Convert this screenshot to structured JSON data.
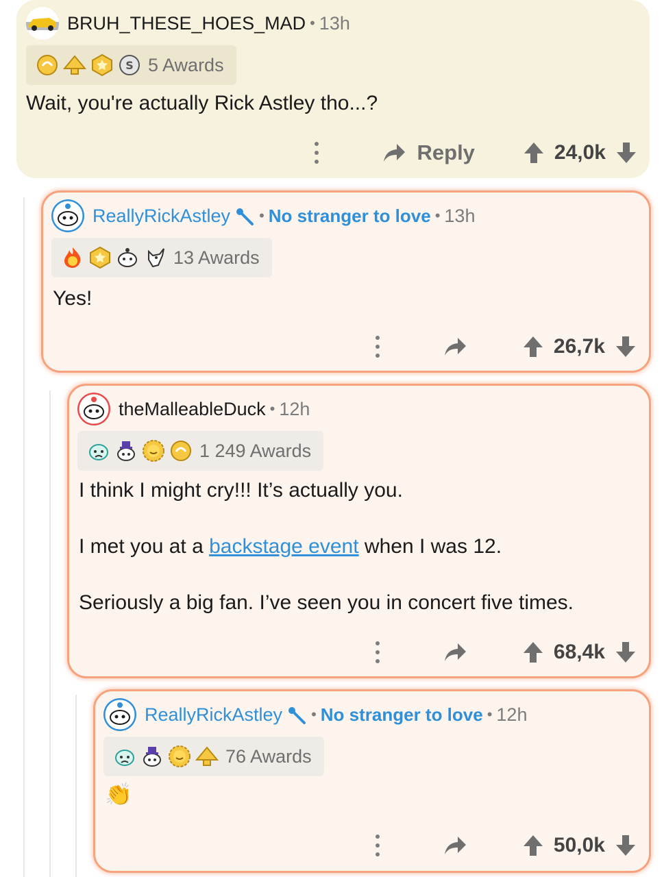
{
  "comments": [
    {
      "username": "BRUH_THESE_HOES_MAD",
      "time": "13h",
      "award_count_label": "5 Awards",
      "award_icons": [
        "wholesome-seal-icon",
        "gold-pyramid-icon",
        "star-badge-icon",
        "silver-coin-icon"
      ],
      "body": "Wait, you're actually Rick Astley tho...?",
      "reply_label": "Reply",
      "score": "24,0k"
    },
    {
      "username": "ReallyRickAstley",
      "flair": "No stranger to love",
      "time": "13h",
      "award_count_label": "13 Awards",
      "award_icons": [
        "fire-award-icon",
        "star-badge-icon",
        "snoo-face-icon",
        "goat-award-icon"
      ],
      "body": "Yes!",
      "score": "26,7k"
    },
    {
      "username": "theMalleableDuck",
      "time": "12h",
      "award_count_label": "1 249 Awards",
      "award_icons": [
        "snoo-tear-icon",
        "snoo-tophat-icon",
        "sun-award-icon",
        "wholesome-seal-icon"
      ],
      "body_line1": "I think I might cry!!! It’s actually you.",
      "body_line2_before": "I met you at a ",
      "body_line2_link": "backstage event",
      "body_line2_after": " when I was 12.",
      "body_line3": "Seriously a big fan. I’ve seen you in concert five times.",
      "score": "68,4k"
    },
    {
      "username": "ReallyRickAstley",
      "flair": "No stranger to love",
      "time": "12h",
      "award_count_label": "76 Awards",
      "award_icons": [
        "snoo-tear-icon",
        "snoo-tophat-icon",
        "sun-award-icon",
        "gold-pyramid-icon"
      ],
      "body": "👏",
      "score": "50,0k"
    }
  ],
  "colors": {
    "accent_blue": "#2f8fd8",
    "highlight_border": "#f5a27d",
    "plain_bg": "#f7f2dd",
    "highlight_bg": "#fdf4ee"
  }
}
